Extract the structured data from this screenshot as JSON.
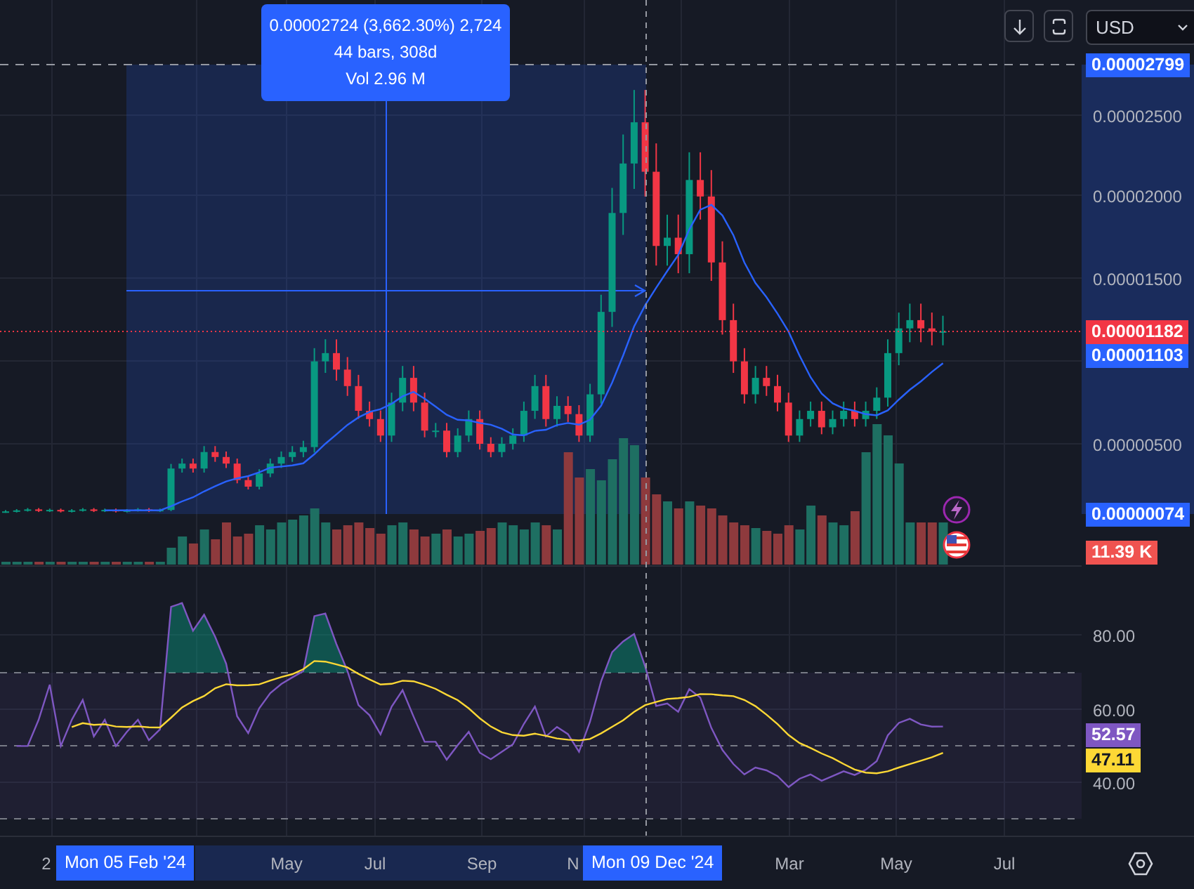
{
  "currency_select": {
    "value": "USD"
  },
  "measure_tooltip": {
    "lines": [
      "0.00002724 (3,662.30%) 2,724",
      "44 bars, 308d",
      "Vol 2.96 M"
    ]
  },
  "price_axis": {
    "labels": [
      {
        "text": "0.00002799",
        "kind": "badge",
        "color": "#2962ff"
      },
      {
        "text": "0.00002500",
        "kind": "tick"
      },
      {
        "text": "0.00002000",
        "kind": "tick"
      },
      {
        "text": "0.00001500",
        "kind": "tick"
      },
      {
        "text": "0.00001182",
        "kind": "badge",
        "color": "#f23645"
      },
      {
        "text": "0.00001103",
        "kind": "badge",
        "color": "#2962ff"
      },
      {
        "text": "0.00000500",
        "kind": "tick"
      },
      {
        "text": "0.00000074",
        "kind": "badge",
        "color": "#2962ff"
      },
      {
        "text": "11.39 K",
        "kind": "badge",
        "color": "#f05350"
      }
    ]
  },
  "rsi_axis": {
    "labels": [
      {
        "text": "80.00",
        "kind": "tick"
      },
      {
        "text": "60.00",
        "kind": "tick"
      },
      {
        "text": "52.57",
        "kind": "badge",
        "color": "#7e57c2"
      },
      {
        "text": "47.11",
        "kind": "badge",
        "color": "#fdd835"
      },
      {
        "text": "40.00",
        "kind": "tick"
      }
    ]
  },
  "time_axis": {
    "labels": [
      {
        "text": "2",
        "kind": "tick"
      },
      {
        "text": "Mon 05 Feb '24",
        "kind": "badge"
      },
      {
        "text": "May",
        "kind": "tick"
      },
      {
        "text": "Jul",
        "kind": "tick"
      },
      {
        "text": "Sep",
        "kind": "tick"
      },
      {
        "text": "N",
        "kind": "tick"
      },
      {
        "text": "Mon 09 Dec '24",
        "kind": "badge"
      },
      {
        "text": "Mar",
        "kind": "tick"
      },
      {
        "text": "May",
        "kind": "tick"
      },
      {
        "text": "Jul",
        "kind": "tick"
      }
    ]
  }
}
